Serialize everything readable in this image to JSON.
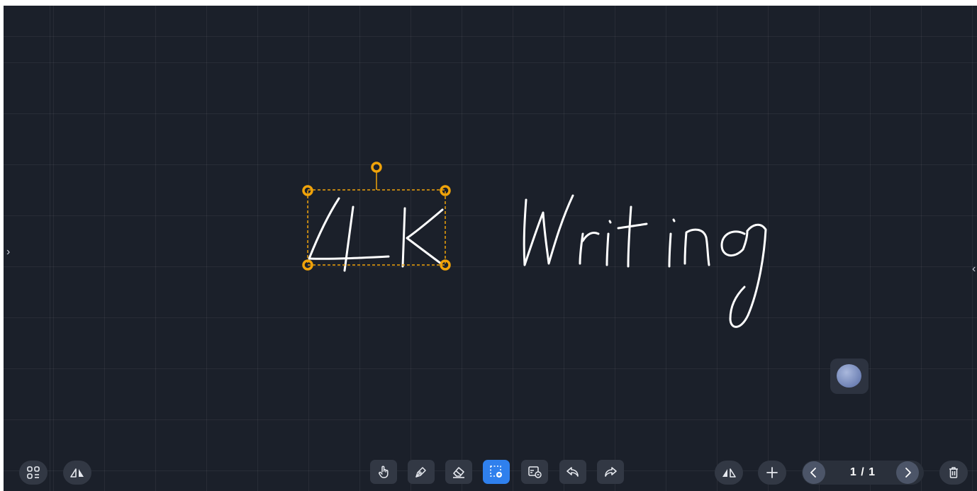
{
  "canvas": {
    "handwriting": "4K Writing",
    "background_color": "#1b202a",
    "selection_color": "#f0a30a"
  },
  "side": {
    "left_arrow": "›",
    "right_arrow": "‹"
  },
  "toolbar_left": {
    "menu_icon": "apps-grid-icon",
    "mirror_icon": "mirror-flip-icon"
  },
  "toolbar_center": {
    "tools": [
      "hand-pointer-icon",
      "pen-icon",
      "eraser-icon",
      "lasso-select-icon",
      "insert-image-icon",
      "undo-icon",
      "redo-icon"
    ],
    "active_tool": "lasso-select-icon",
    "active_color": "#2f80ed"
  },
  "toolbar_right": {
    "page_indicator": "1 / 1",
    "add_page_icon": "plus-icon",
    "prev_icon": "chevron-left-icon",
    "next_icon": "chevron-right-icon",
    "delete_icon": "trash-icon"
  }
}
